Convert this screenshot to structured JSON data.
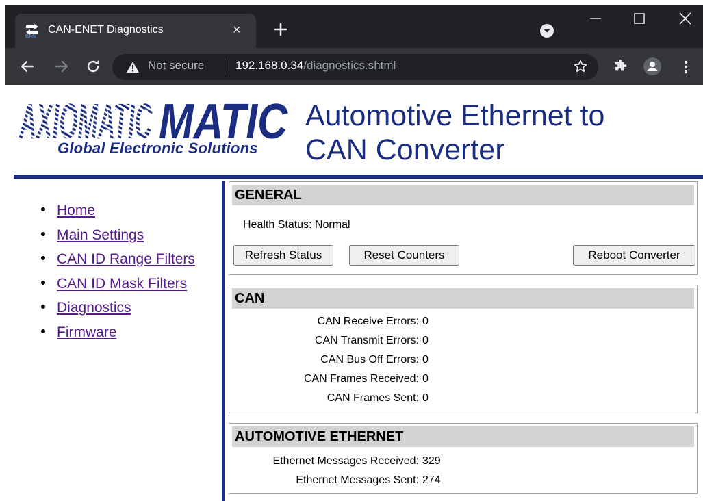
{
  "browser": {
    "tab_title": "CAN-ENET Diagnostics",
    "tab_close": "×",
    "security_label": "Not secure",
    "url_host": "192.168.0.34",
    "url_path": "/diagnostics.shtml"
  },
  "header": {
    "logo_text": "AXIOMATIC",
    "logo_subtitle": "Global Electronic Solutions",
    "title_line1": "Automotive Ethernet to",
    "title_line2": "CAN Converter",
    "brand_color": "#1b2d80"
  },
  "nav": {
    "items": [
      {
        "label": "Home"
      },
      {
        "label": "Main Settings"
      },
      {
        "label": "CAN ID Range Filters"
      },
      {
        "label": "CAN ID Mask Filters"
      },
      {
        "label": "Diagnostics"
      },
      {
        "label": "Firmware"
      }
    ]
  },
  "general": {
    "heading": "GENERAL",
    "health_label": "Health Status:",
    "health_value": "Normal",
    "refresh_button": "Refresh Status",
    "reset_button": "Reset Counters",
    "reboot_button": "Reboot Converter"
  },
  "can": {
    "heading": "CAN",
    "rows": [
      {
        "label": "CAN Receive Errors:",
        "value": "0"
      },
      {
        "label": "CAN Transmit Errors:",
        "value": "0"
      },
      {
        "label": "CAN Bus Off Errors:",
        "value": "0"
      },
      {
        "label": "CAN Frames Received:",
        "value": "0"
      },
      {
        "label": "CAN Frames Sent:",
        "value": "0"
      }
    ]
  },
  "ethernet": {
    "heading": "AUTOMOTIVE ETHERNET",
    "rows": [
      {
        "label": "Ethernet Messages Received:",
        "value": "329"
      },
      {
        "label": "Ethernet Messages Sent:",
        "value": "274"
      }
    ]
  }
}
